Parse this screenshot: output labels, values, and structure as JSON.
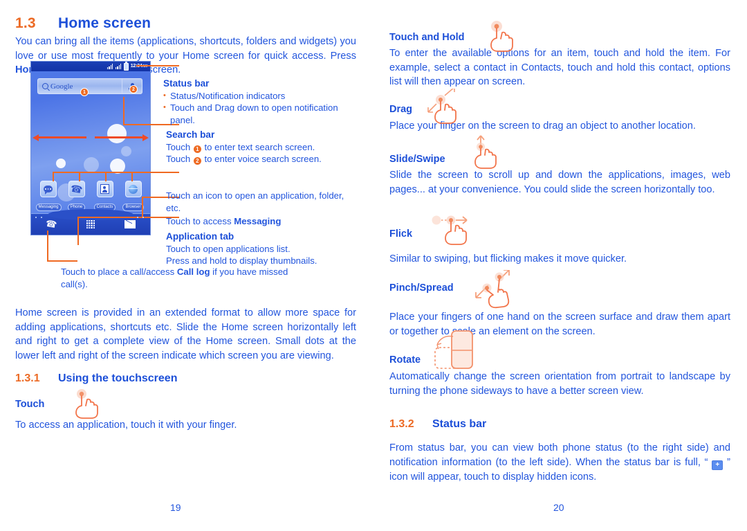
{
  "document": {
    "left_page_number": "19",
    "right_page_number": "20"
  },
  "colors": {
    "heading_blue": "#1c4fd8",
    "body_blue": "#2255dd",
    "accent_orange": "#ec6a24",
    "leader_orange": "#ef6a22",
    "phone_blue": "#4f7ae8"
  },
  "left": {
    "section": {
      "number": "1.3",
      "title": "Home screen"
    },
    "intro": "You can bring all the items (applications, shortcuts, folders and widgets) you love or use most frequently to your Home screen for quick access. Press ",
    "intro_bold": "Home",
    "intro_tail": " key to switch to Home screen.",
    "phone": {
      "status_bar": {
        "time": "12:34",
        "meridiem": "AM"
      },
      "search": {
        "label": "Google",
        "badge_1": "1",
        "badge_2": "2"
      },
      "apps": [
        {
          "label": "Messaging",
          "icon": "messaging-icon"
        },
        {
          "label": "Phone",
          "icon": "phone-icon"
        },
        {
          "label": "Contacts",
          "icon": "contacts-icon"
        },
        {
          "label": "Browser",
          "icon": "browser-icon"
        }
      ],
      "dock": [
        {
          "icon": "call-icon"
        },
        {
          "icon": "application-tab-icon"
        },
        {
          "icon": "mail-icon"
        }
      ]
    },
    "callouts": {
      "status_bar": {
        "title": "Status bar",
        "bullets": [
          "Status/Notification indicators",
          "Touch and Drag down to open notification panel."
        ]
      },
      "search_bar": {
        "title": "Search bar",
        "line1_pre": "Touch ",
        "line1_badge": "1",
        "line1_post": " to enter text search screen.",
        "line2_pre": "Touch ",
        "line2_badge": "2",
        "line2_post": " to enter voice search screen."
      },
      "app_icon": "Touch an icon to open an application, folder, etc.",
      "messaging": {
        "pre": "Touch to access ",
        "bold": "Messaging",
        "post": ""
      },
      "application_tab": {
        "title": "Application tab",
        "line1": "Touch to open applications list.",
        "line2": "Press and hold to display thumbnails."
      },
      "call_log": {
        "pre": "Touch to place a call/access ",
        "bold": "Call log",
        "post": " if you have missed call(s)."
      }
    },
    "paragraph": "Home screen is provided in an extended format to allow more space for adding applications, shortcuts etc. Slide the Home screen horizontally left and right to get a complete view of the Home screen. Small dots at the lower left and right of the screen indicate which screen you are viewing.",
    "subsection": {
      "number": "1.3.1",
      "title": "Using the touchscreen"
    },
    "touch": {
      "heading": "Touch",
      "body": "To access an application, touch it with your finger."
    }
  },
  "right": {
    "touch_and_hold": {
      "heading": "Touch and Hold",
      "body": "To enter the available options for an item, touch and hold the item. For example, select a contact in Contacts, touch and hold this contact, options list will then appear on screen."
    },
    "drag": {
      "heading": "Drag",
      "body": "Place your finger on the screen to drag an object to another location."
    },
    "slide_swipe": {
      "heading": "Slide/Swipe",
      "body": "Slide the screen to scroll up and down the applications, images, web pages... at your convenience. You could slide the screen horizontally too."
    },
    "flick": {
      "heading": "Flick",
      "body": "Similar to swiping, but flicking makes it move quicker."
    },
    "pinch_spread": {
      "heading": "Pinch/Spread",
      "body": "Place your fingers of one hand on the screen surface and draw them apart or together to scale an element on the screen."
    },
    "rotate": {
      "heading": "Rotate",
      "body": "Automatically change the screen orientation from portrait to landscape by turning the phone sideways to have a better screen view."
    },
    "subsection": {
      "number": "1.3.2",
      "title": "Status bar"
    },
    "status_bar_body_pre": "From status bar, you can view both phone status (to the right side) and notification information (to the left side). When the status bar is full, “ ",
    "status_bar_icon": "+",
    "status_bar_body_post": " ” icon will appear, touch to display hidden icons."
  }
}
